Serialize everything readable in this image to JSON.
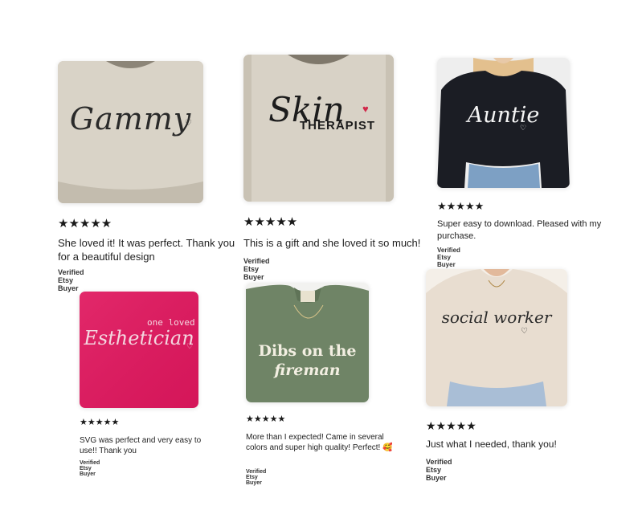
{
  "colors": {
    "background": "#ffffff",
    "star": "#1a1a1a",
    "text": "#1f1f1f",
    "heart_accent": "#d1294a"
  },
  "reviews": [
    {
      "shirt_text": "Gammy",
      "shirt_color": "#d9d3c7",
      "rating": 5,
      "stars_glyph": "★★★★★",
      "text": "She loved it! It was perfect. Thank you for a beautiful design",
      "buyer": "Verified Etsy Buyer"
    },
    {
      "shirt_text": "Skin",
      "shirt_text_2": "THERAPIST",
      "shirt_color": "#d8d2c6",
      "rating": 5,
      "stars_glyph": "★★★★★",
      "text": "This is a gift and she loved it so much!",
      "buyer": "Verified Etsy Buyer"
    },
    {
      "shirt_text": "Auntie",
      "shirt_color": "#1b1d24",
      "rating": 5,
      "stars_glyph": "★★★★★",
      "text": "Super easy to download. Pleased with my purchase.",
      "buyer": "Verified Etsy Buyer"
    },
    {
      "shirt_text": "Esthetician",
      "shirt_text_2": "one loved",
      "shirt_color": "#e0175e",
      "rating": 5,
      "stars_glyph": "★★★★★",
      "text": "SVG was perfect and very easy to use!! Thank you",
      "buyer": "Verified Etsy Buyer"
    },
    {
      "shirt_text": "Dibs on the",
      "shirt_text_2": "fireman",
      "shirt_color": "#6f8466",
      "rating": 5,
      "stars_glyph": "★★★★★",
      "text": "More than I expected! Came in several colors and super high quality! Perfect! 🥰",
      "buyer": "Verified Etsy Buyer"
    },
    {
      "shirt_text": "social worker",
      "shirt_color": "#e8ddd0",
      "rating": 5,
      "stars_glyph": "★★★★★",
      "text": "Just what I needed, thank you!",
      "buyer": "Verified Etsy Buyer"
    }
  ]
}
